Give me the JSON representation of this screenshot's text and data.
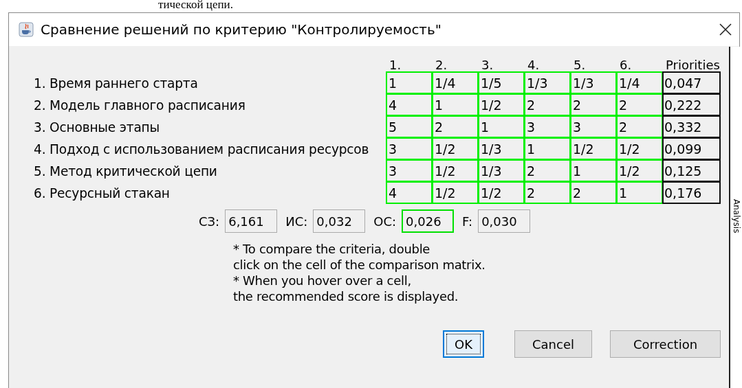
{
  "background_text": "тической цепи.",
  "window": {
    "title": "Сравнение решений по критерию \"Контролируемость\""
  },
  "matrix": {
    "columns": [
      "1.",
      "2.",
      "3.",
      "4.",
      "5.",
      "6.",
      "Priorities"
    ],
    "rows": [
      {
        "label": "1. Время раннего старта",
        "cells": [
          "1",
          "1/4",
          "1/5",
          "1/3",
          "1/3",
          "1/4"
        ],
        "priority": "0,047"
      },
      {
        "label": "2. Модель главного расписания",
        "cells": [
          "4",
          "1",
          "1/2",
          "2",
          "2",
          "2"
        ],
        "priority": "0,222"
      },
      {
        "label": "3. Основные этапы",
        "cells": [
          "5",
          "2",
          "1",
          "3",
          "3",
          "2"
        ],
        "priority": "0,332"
      },
      {
        "label": "4. Подход с использованием расписания ресурсов",
        "cells": [
          "3",
          "1/2",
          "1/3",
          "1",
          "1/2",
          "1/2"
        ],
        "priority": "0,099"
      },
      {
        "label": "5. Метод критической цепи",
        "cells": [
          "3",
          "1/2",
          "1/3",
          "2",
          "1",
          "1/2"
        ],
        "priority": "0,125"
      },
      {
        "label": "6. Ресурсный стакан",
        "cells": [
          "4",
          "1/2",
          "1/2",
          "2",
          "2",
          "1"
        ],
        "priority": "0,176"
      }
    ]
  },
  "stats": [
    {
      "label": "СЗ:",
      "value": "6,161",
      "highlighted": false
    },
    {
      "label": "ИС:",
      "value": "0,032",
      "highlighted": false
    },
    {
      "label": "ОС:",
      "value": "0,026",
      "highlighted": true
    },
    {
      "label": "F:",
      "value": "0,030",
      "highlighted": false
    }
  ],
  "notes": [
    "* To compare the criteria, double",
    "click on the cell of the comparison matrix.",
    "* When you hover over a cell,",
    "the recommended score is displayed."
  ],
  "buttons": [
    {
      "label": "OK",
      "focused": true
    },
    {
      "label": "Cancel",
      "focused": false
    },
    {
      "label": "Correction",
      "focused": false
    }
  ],
  "side_panel": {
    "title": "Analysis"
  }
}
